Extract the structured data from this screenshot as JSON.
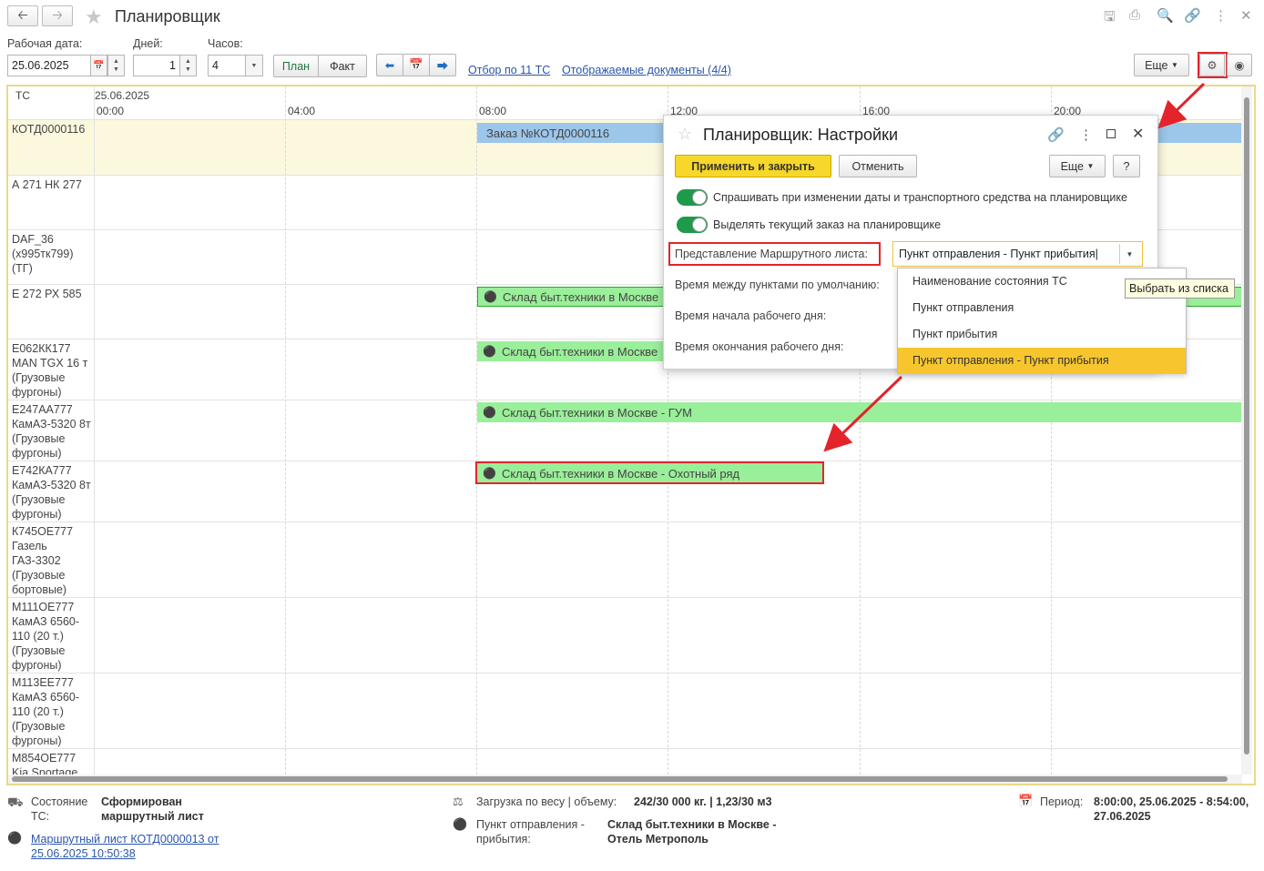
{
  "window": {
    "title": "Планировщик"
  },
  "toolbar": {
    "date_label": "Рабочая дата:",
    "date_value": "25.06.2025",
    "days_label": "Дней:",
    "days_value": "1",
    "hours_label": "Часов:",
    "hours_value": "4",
    "plan_label": "План",
    "fact_label": "Факт",
    "filter_link": "Отбор по 11 ТС",
    "docs_link": "Отображаемые документы (4/4)",
    "more_label": "Еще"
  },
  "grid": {
    "col_header": "ТС",
    "date": "25.06.2025",
    "hours": [
      "00:00",
      "04:00",
      "08:00",
      "12:00",
      "16:00",
      "20:00"
    ],
    "rows": [
      {
        "label": "КОТД0000116"
      },
      {
        "label": "А 271 НК 277"
      },
      {
        "label": "DAF_36 (х995тк799) (ТГ)"
      },
      {
        "label": "Е 272 РХ 585"
      },
      {
        "label": "Е062КК177 MAN TGX 16 т (Грузовые фургоны)"
      },
      {
        "label": "Е247АА777 КамАЗ-5320 8т (Грузовые фургоны)"
      },
      {
        "label": "Е742КА777 КамАЗ-5320 8т (Грузовые фургоны)"
      },
      {
        "label": "К745ОЕ777 Газель ГАЗ-3302 (Грузовые бортовые)"
      },
      {
        "label": "М111ОЕ777 КамАЗ 6560-110 (20 т.) (Грузовые фургоны)"
      },
      {
        "label": "М113ЕЕ777 КамАЗ 6560-110 (20 т.) (Грузовые фургоны)"
      },
      {
        "label": "М854ОЕ777 Kia Sportage"
      }
    ],
    "bars": {
      "order": "Заказ №КОТД0000116",
      "row3": "Склад быт.техники в Москве",
      "row4": "Склад быт.техники в Москве",
      "row5": "Склад быт.техники в Москве - ГУМ",
      "row6": "Склад быт.техники в Москве - Охотный ряд"
    }
  },
  "dialog": {
    "title": "Планировщик: Настройки",
    "apply_label": "Применить и закрыть",
    "cancel_label": "Отменить",
    "more_label": "Еще",
    "help_label": "?",
    "toggle1": "Спрашивать при изменении даты и транспортного средства на планировщике",
    "toggle2": "Выделять текущий заказ на планировщике",
    "route_label": "Представление Маршрутного листа:",
    "route_value": "Пункт отправления - Пункт прибытия",
    "time_between": "Время между пунктами по умолчанию:",
    "day_start": "Время начала рабочего дня:",
    "day_end": "Время окончания рабочего дня:"
  },
  "dropdown": {
    "options": [
      "Наименование состояния ТС",
      "Пункт отправления",
      "Пункт прибытия",
      "Пункт отправления - Пункт прибытия"
    ],
    "tooltip": "Выбрать из списка"
  },
  "footer": {
    "state_label": "Состояние ТС:",
    "state_value": "Сформирован маршрутный лист",
    "route_link": "Маршрутный лист КОТД0000013 от 25.06.2025 10:50:38",
    "load_label": "Загрузка по весу | объему:",
    "load_value": "242/30 000 кг. | 1,23/30 м3",
    "points_label": "Пункт отправления - прибытия:",
    "points_value": "Склад быт.техники в Москве - Отель Метрополь",
    "period_label": "Период:",
    "period_value": "8:00:00, 25.06.2025 - 8:54:00, 27.06.2025"
  },
  "colors": {
    "accent": "#f7c62f",
    "bar_green": "#9aef9a",
    "bar_blue": "#9cc6ea",
    "highlight_row": "#fbf8de",
    "annotation_red": "#e3242b"
  }
}
